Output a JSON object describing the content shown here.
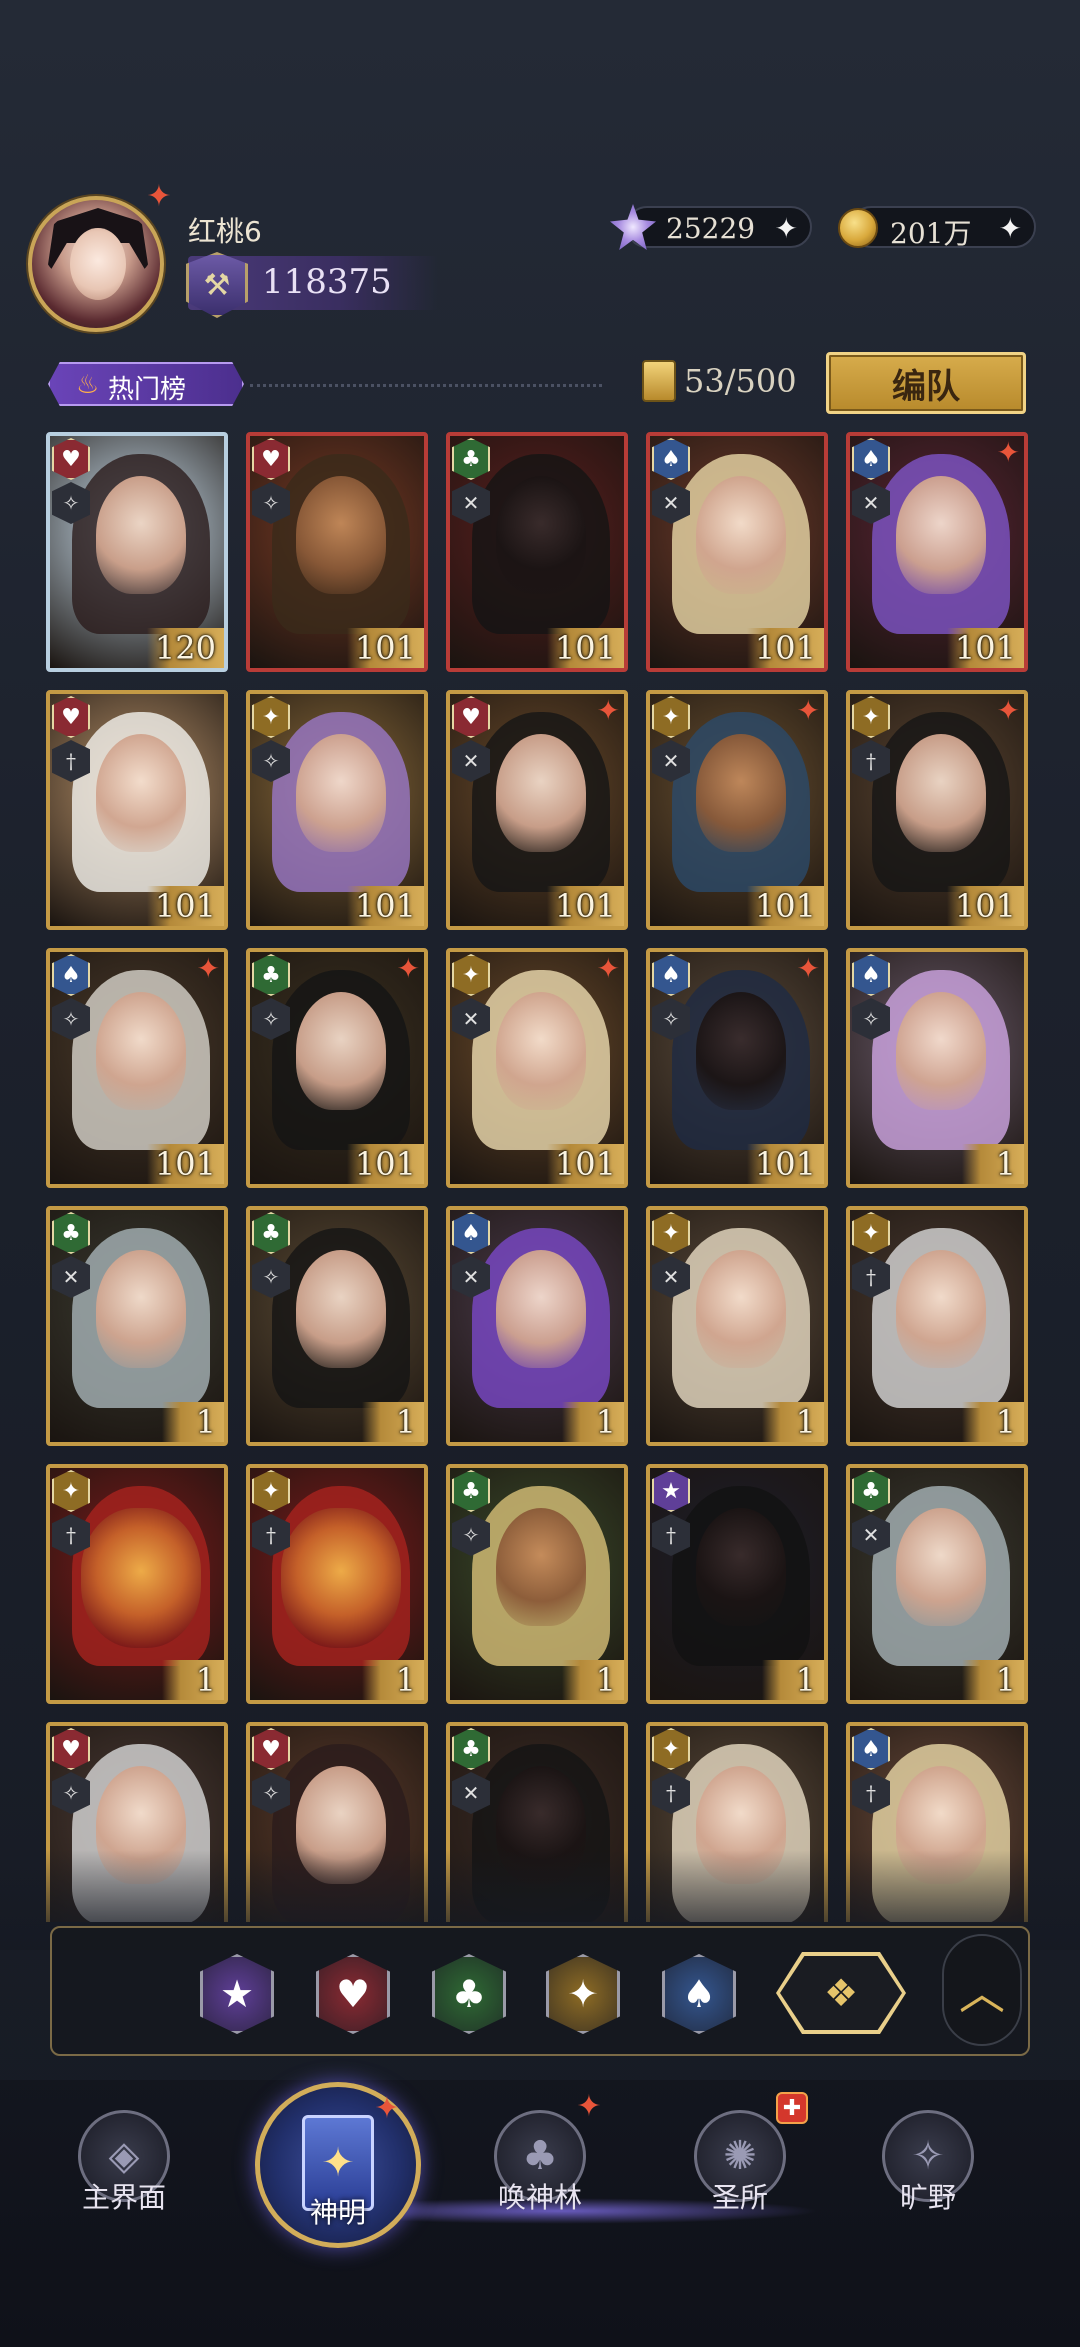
{
  "player": {
    "name": "红桃6",
    "power": "118375"
  },
  "currencies": {
    "gems": {
      "value": "25229",
      "plus": "✦",
      "icon": "star-gem-icon"
    },
    "coins": {
      "value": "201万",
      "plus": "✦",
      "icon": "coin-icon"
    }
  },
  "ranking": {
    "tab_label": "热门榜",
    "capacity": "53/500",
    "team_button": "编队"
  },
  "suits": {
    "heart": {
      "symbol": "♥",
      "color": "#8a2a32"
    },
    "club": {
      "symbol": "♣",
      "color": "#2f6a34"
    },
    "spade": {
      "symbol": "♠",
      "color": "#34568f"
    },
    "diamond": {
      "symbol": "✦",
      "color": "#8e6c24"
    },
    "star": {
      "symbol": "★",
      "color": "#5f3f98"
    }
  },
  "cards": [
    {
      "suit": "heart",
      "cls": "✧",
      "level": "120",
      "frame": "silver",
      "bg": "#cfe3f2",
      "hair": "#2a1c1c",
      "face": "light",
      "spark": false
    },
    {
      "suit": "heart",
      "cls": "✧",
      "level": "101",
      "frame": "red",
      "bg": "#7a3a24",
      "hair": "#3a2a1a",
      "face": "tan",
      "spark": false
    },
    {
      "suit": "club",
      "cls": "✕",
      "level": "101",
      "frame": "red",
      "bg": "#5c1e1e",
      "hair": "#141414",
      "face": "dark",
      "spark": false
    },
    {
      "suit": "spade",
      "cls": "✕",
      "level": "101",
      "frame": "red",
      "bg": "#6e3a2a",
      "hair": "#ead8a8",
      "face": "light",
      "spark": false
    },
    {
      "suit": "spade",
      "cls": "✕",
      "level": "101",
      "frame": "red",
      "bg": "#5a2434",
      "hair": "#7e55c8",
      "face": "light",
      "spark": true
    },
    {
      "suit": "heart",
      "cls": "†",
      "level": "101",
      "frame": "gold",
      "bg": "#b8926a",
      "hair": "#f4f2ee",
      "face": "light",
      "spark": false
    },
    {
      "suit": "diamond",
      "cls": "✧",
      "level": "101",
      "frame": "gold",
      "bg": "#8a6a3a",
      "hair": "#9a78c8",
      "face": "light",
      "spark": false
    },
    {
      "suit": "heart",
      "cls": "✕",
      "level": "101",
      "frame": "gold",
      "bg": "#6a4a2a",
      "hair": "#151515",
      "face": "light",
      "spark": true
    },
    {
      "suit": "diamond",
      "cls": "✕",
      "level": "101",
      "frame": "gold",
      "bg": "#6a5030",
      "hair": "#2a4a6a",
      "face": "tan",
      "spark": true
    },
    {
      "suit": "diamond",
      "cls": "†",
      "level": "101",
      "frame": "gold",
      "bg": "#5a4430",
      "hair": "#151515",
      "face": "light",
      "spark": true
    },
    {
      "suit": "spade",
      "cls": "✧",
      "level": "101",
      "frame": "gold",
      "bg": "#4a3a2a",
      "hair": "#d8d4cc",
      "face": "light",
      "spark": true
    },
    {
      "suit": "club",
      "cls": "✧",
      "level": "101",
      "frame": "gold",
      "bg": "#3a3020",
      "hair": "#141414",
      "face": "light",
      "spark": true
    },
    {
      "suit": "diamond",
      "cls": "✕",
      "level": "101",
      "frame": "gold",
      "bg": "#6a4a2a",
      "hair": "#eddcb0",
      "face": "light",
      "spark": true
    },
    {
      "suit": "spade",
      "cls": "✧",
      "level": "101",
      "frame": "gold",
      "bg": "#5a4a3a",
      "hair": "#1e2a44",
      "face": "dark",
      "spark": true
    },
    {
      "suit": "spade",
      "cls": "✧",
      "level": "1",
      "frame": "gold",
      "bg": "#6a5a6a",
      "hair": "#cfa6e4",
      "face": "light",
      "spark": false
    },
    {
      "suit": "club",
      "cls": "✕",
      "level": "1",
      "frame": "gold",
      "bg": "#3a3a30",
      "hair": "#a8b4b8",
      "face": "light",
      "spark": false
    },
    {
      "suit": "club",
      "cls": "✧",
      "level": "1",
      "frame": "gold",
      "bg": "#5a4a34",
      "hair": "#141414",
      "face": "light",
      "spark": false
    },
    {
      "suit": "spade",
      "cls": "✕",
      "level": "1",
      "frame": "gold",
      "bg": "#4a3a4a",
      "hair": "#7a48c8",
      "face": "light",
      "spark": false
    },
    {
      "suit": "diamond",
      "cls": "✕",
      "level": "1",
      "frame": "gold",
      "bg": "#5a4a3a",
      "hair": "#e8dcc4",
      "face": "light",
      "spark": false
    },
    {
      "suit": "diamond",
      "cls": "†",
      "level": "1",
      "frame": "gold",
      "bg": "#4a3a30",
      "hair": "#d8d8d8",
      "face": "light",
      "spark": false
    },
    {
      "suit": "diamond",
      "cls": "†",
      "level": "1",
      "frame": "gold",
      "bg": "#7a1a1a",
      "hair": "#a8231e",
      "face": "lion",
      "spark": false
    },
    {
      "suit": "diamond",
      "cls": "†",
      "level": "1",
      "frame": "gold",
      "bg": "#7a1a1a",
      "hair": "#a8231e",
      "face": "lion",
      "spark": false
    },
    {
      "suit": "club",
      "cls": "✧",
      "level": "1",
      "frame": "gold",
      "bg": "#3a4a2a",
      "hair": "#d8c078",
      "face": "tan",
      "spark": false
    },
    {
      "suit": "star",
      "cls": "†",
      "level": "1",
      "frame": "gold",
      "bg": "#1e1e2a",
      "hair": "#121212",
      "face": "dark",
      "spark": false
    },
    {
      "suit": "club",
      "cls": "✕",
      "level": "1",
      "frame": "gold",
      "bg": "#3a3a30",
      "hair": "#a8b4b8",
      "face": "light",
      "spark": false
    },
    {
      "suit": "heart",
      "cls": "✧",
      "level": "",
      "frame": "gold",
      "bg": "#4a3a34",
      "hair": "#d8d8d8",
      "face": "light",
      "spark": false
    },
    {
      "suit": "heart",
      "cls": "✧",
      "level": "",
      "frame": "gold",
      "bg": "#5a3a2a",
      "hair": "#2a1c1c",
      "face": "light",
      "spark": false
    },
    {
      "suit": "club",
      "cls": "✕",
      "level": "",
      "frame": "gold",
      "bg": "#3a2a24",
      "hair": "#141414",
      "face": "dark",
      "spark": false
    },
    {
      "suit": "diamond",
      "cls": "†",
      "level": "",
      "frame": "gold",
      "bg": "#5a4a3a",
      "hair": "#e8dcc4",
      "face": "light",
      "spark": false
    },
    {
      "suit": "spade",
      "cls": "†",
      "level": "",
      "frame": "gold",
      "bg": "#6a4a3a",
      "hair": "#ead8a8",
      "face": "light",
      "spark": false
    }
  ],
  "filters": [
    {
      "name": "filter-star",
      "symbol": "★",
      "color": "#5f3f98"
    },
    {
      "name": "filter-heart",
      "symbol": "♥",
      "color": "#8a2a32"
    },
    {
      "name": "filter-club",
      "symbol": "♣",
      "color": "#2f6a34"
    },
    {
      "name": "filter-diamond",
      "symbol": "✦",
      "color": "#8e6c24"
    },
    {
      "name": "filter-spade",
      "symbol": "♠",
      "color": "#34568f"
    }
  ],
  "filter_all_symbol": "❖",
  "collapse_symbol": "︿",
  "nav": [
    {
      "key": "main",
      "label": "主界面",
      "icon": "main-world-icon",
      "symbol": "◈"
    },
    {
      "key": "gods",
      "label": "神明",
      "icon": "gods-card-icon",
      "symbol": "✦",
      "active": true
    },
    {
      "key": "summon",
      "label": "唤神林",
      "icon": "summon-tree-icon",
      "symbol": "♣"
    },
    {
      "key": "sanctuary",
      "label": "圣所",
      "icon": "sanctuary-icon",
      "symbol": "✺"
    },
    {
      "key": "wild",
      "label": "旷野",
      "icon": "compass-icon",
      "symbol": "✧"
    }
  ]
}
